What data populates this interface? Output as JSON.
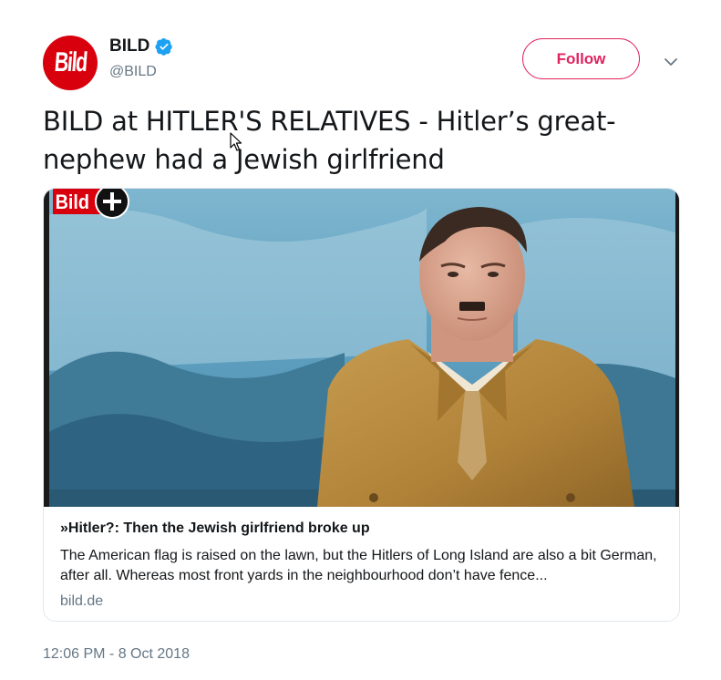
{
  "account": {
    "avatar_text": "Bild",
    "display_name": "BILD",
    "handle": "@BILD",
    "verified": true
  },
  "actions": {
    "follow_label": "Follow",
    "menu_icon": "chevron-down-icon"
  },
  "tweet": {
    "text": "BILD at HITLER'S RELATIVES - Hitler’s great-nephew had a Jewish girlfriend",
    "timestamp": "12:06 PM - 8 Oct 2018"
  },
  "card": {
    "image_badge": "Bild",
    "title": "»Hitler?: Then the Jewish girlfriend broke up",
    "description": "The American flag is raised on the lawn, but the Hitlers of Long Island are also a bit German, after all. Whereas most front yards in the neighbourhood don’t have fence...",
    "domain": "bild.de"
  },
  "colors": {
    "brand_red": "#d9000d",
    "follow_accent": "#e0245e",
    "verified_blue": "#1da1f2",
    "muted_text": "#657786",
    "primary_text": "#14171a"
  }
}
